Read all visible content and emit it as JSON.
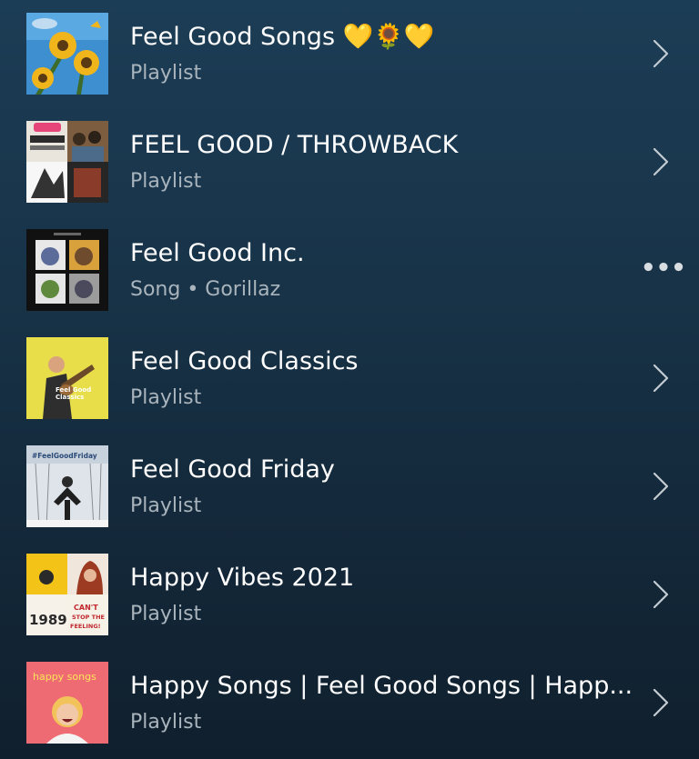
{
  "results": [
    {
      "title": "Feel Good Songs 💛🌻💛",
      "subtitle": "Playlist",
      "action_icon": "chevron-right-icon",
      "art": "sunflowers-cover"
    },
    {
      "title": "FEEL GOOD / THROWBACK",
      "subtitle": "Playlist",
      "action_icon": "chevron-right-icon",
      "art": "collage-cover"
    },
    {
      "title": "Feel Good Inc.",
      "subtitle": "Song • Gorillaz",
      "action_icon": "more-options-icon",
      "more_label": "•••",
      "art": "gorillaz-cover"
    },
    {
      "title": "Feel Good Classics",
      "subtitle": "Playlist",
      "action_icon": "chevron-right-icon",
      "art": "classics-cover",
      "cover_text": "Feel Good Classics"
    },
    {
      "title": "Feel Good Friday",
      "subtitle": "Playlist",
      "action_icon": "chevron-right-icon",
      "art": "friday-cover",
      "cover_text": "#FeelGoodFriday"
    },
    {
      "title": "Happy Vibes 2021",
      "subtitle": "Playlist",
      "action_icon": "chevron-right-icon",
      "art": "happy-vibes-cover",
      "cover_text_a": "1989",
      "cover_text_b": "CAN'T STOP THE FEELING!"
    },
    {
      "title": "Happy Songs | Feel Good Songs | Happ...",
      "subtitle": "Playlist",
      "action_icon": "chevron-right-icon",
      "art": "happy-songs-cover",
      "cover_text": "happy songs"
    }
  ],
  "colors": {
    "background_top": "#1c3d56",
    "background_bottom": "#101f2d",
    "title": "#ffffff",
    "subtitle": "#a9b4bc",
    "chevron": "#c4ccd3"
  }
}
